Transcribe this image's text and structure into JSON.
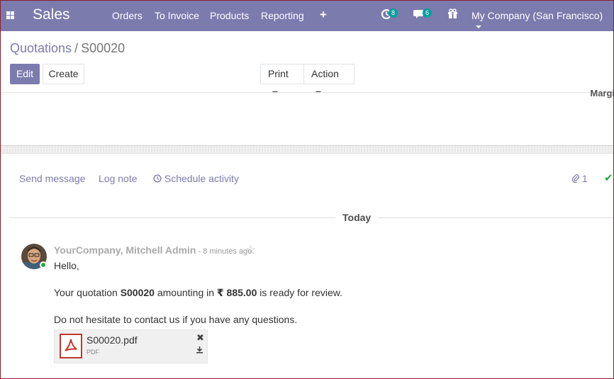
{
  "navbar": {
    "brand": "Sales",
    "menu": [
      "Orders",
      "To Invoice",
      "Products",
      "Reporting"
    ],
    "activity_count": "8",
    "message_count": "6",
    "company": "My Company (San Francisco)"
  },
  "breadcrumb": {
    "parent": "Quotations",
    "separator": "/",
    "current": "S00020"
  },
  "controls": {
    "edit": "Edit",
    "create": "Create",
    "print": "Print",
    "action": "Action"
  },
  "sheet": {
    "margin_label": "Margin"
  },
  "chatter": {
    "send_message": "Send message",
    "log_note": "Log note",
    "schedule_activity": "Schedule activity",
    "attachment_count": "1",
    "date_separator": "Today"
  },
  "message": {
    "author": "YourCompany, Mitchell Admin",
    "time": " - 8 minutes ago",
    "greeting": "Hello,",
    "body_prefix": "Your quotation ",
    "order_ref": "S00020",
    "body_mid": " amounting in ",
    "amount": "₹ 885.00",
    "body_suffix": " is ready for review.",
    "closing": "Do not hesitate to contact us if you have any questions.",
    "attachment": {
      "name": "S00020.pdf",
      "type": "PDF"
    }
  },
  "colors": {
    "brand": "#7c7bad",
    "badge": "#00a09d",
    "online": "#28a745"
  }
}
